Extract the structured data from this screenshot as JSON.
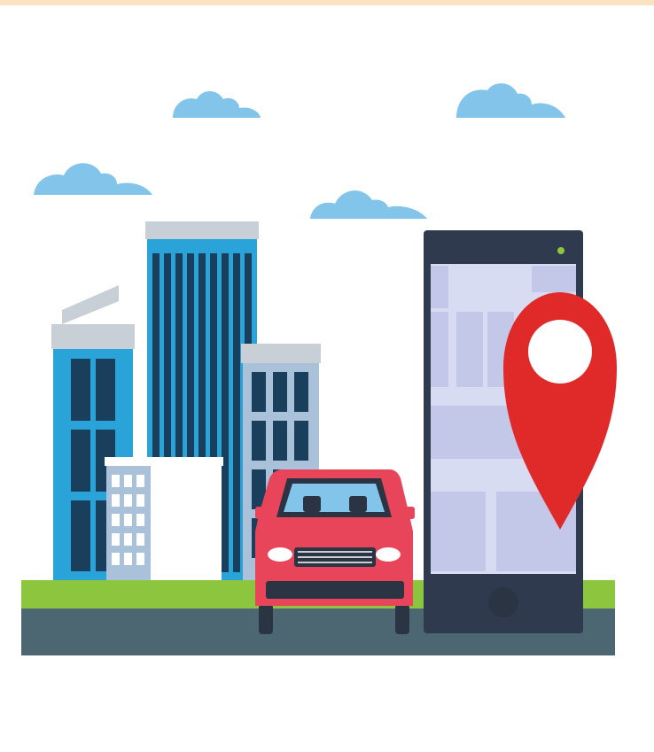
{
  "image": {
    "description_free": true,
    "palette": {
      "background": "#ffffff",
      "top_strip": "#fbe2c0",
      "cloud": "#82c4ea",
      "grass": "#8cc63f",
      "road": "#4c6672",
      "car_body": "#e8455a",
      "car_dark": "#2b3442",
      "phone_frame": "#2f3a4e",
      "phone_screen": "#d8dcf2",
      "phone_block": "#c4c8e8",
      "pin": "#e02a2a",
      "building_blue": "#2aa3d9",
      "building_dark": "#1a3f5c",
      "building_roof": "#c8cfd6",
      "building_light": "#a9c2da",
      "window_white": "#ffffff",
      "indicator_green": "#8cc63f"
    },
    "icons": [
      "cloud-icon",
      "building-icon",
      "car-icon",
      "smartphone-icon",
      "location-pin-icon"
    ]
  }
}
